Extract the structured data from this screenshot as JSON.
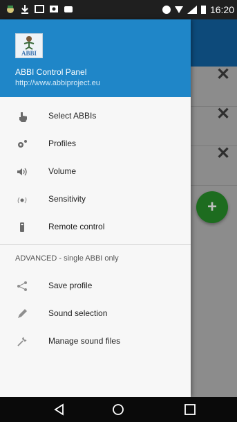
{
  "status_bar": {
    "time": "16:20"
  },
  "drawer": {
    "app_name": "ABBI Control Panel",
    "url": "http://www.abbiproject.eu",
    "logo_text": "ABBI",
    "items": [
      {
        "label": "Select ABBIs",
        "icon": "hand-pointer-icon"
      },
      {
        "label": "Profiles",
        "icon": "gears-icon"
      },
      {
        "label": "Volume",
        "icon": "volume-icon"
      },
      {
        "label": "Sensitivity",
        "icon": "sensitivity-icon"
      },
      {
        "label": "Remote control",
        "icon": "remote-icon"
      }
    ],
    "advanced_header": "ADVANCED - single ABBI only",
    "advanced_items": [
      {
        "label": "Save profile",
        "icon": "share-icon"
      },
      {
        "label": "Sound selection",
        "icon": "pencil-icon"
      },
      {
        "label": "Manage sound files",
        "icon": "wrench-icon"
      }
    ]
  },
  "background": {
    "close_glyph": "✕",
    "fab_glyph": "+"
  },
  "colors": {
    "drawer_header": "#1f86c8",
    "toolbar": "#0d4a7a",
    "fab": "#1d6c1f"
  }
}
